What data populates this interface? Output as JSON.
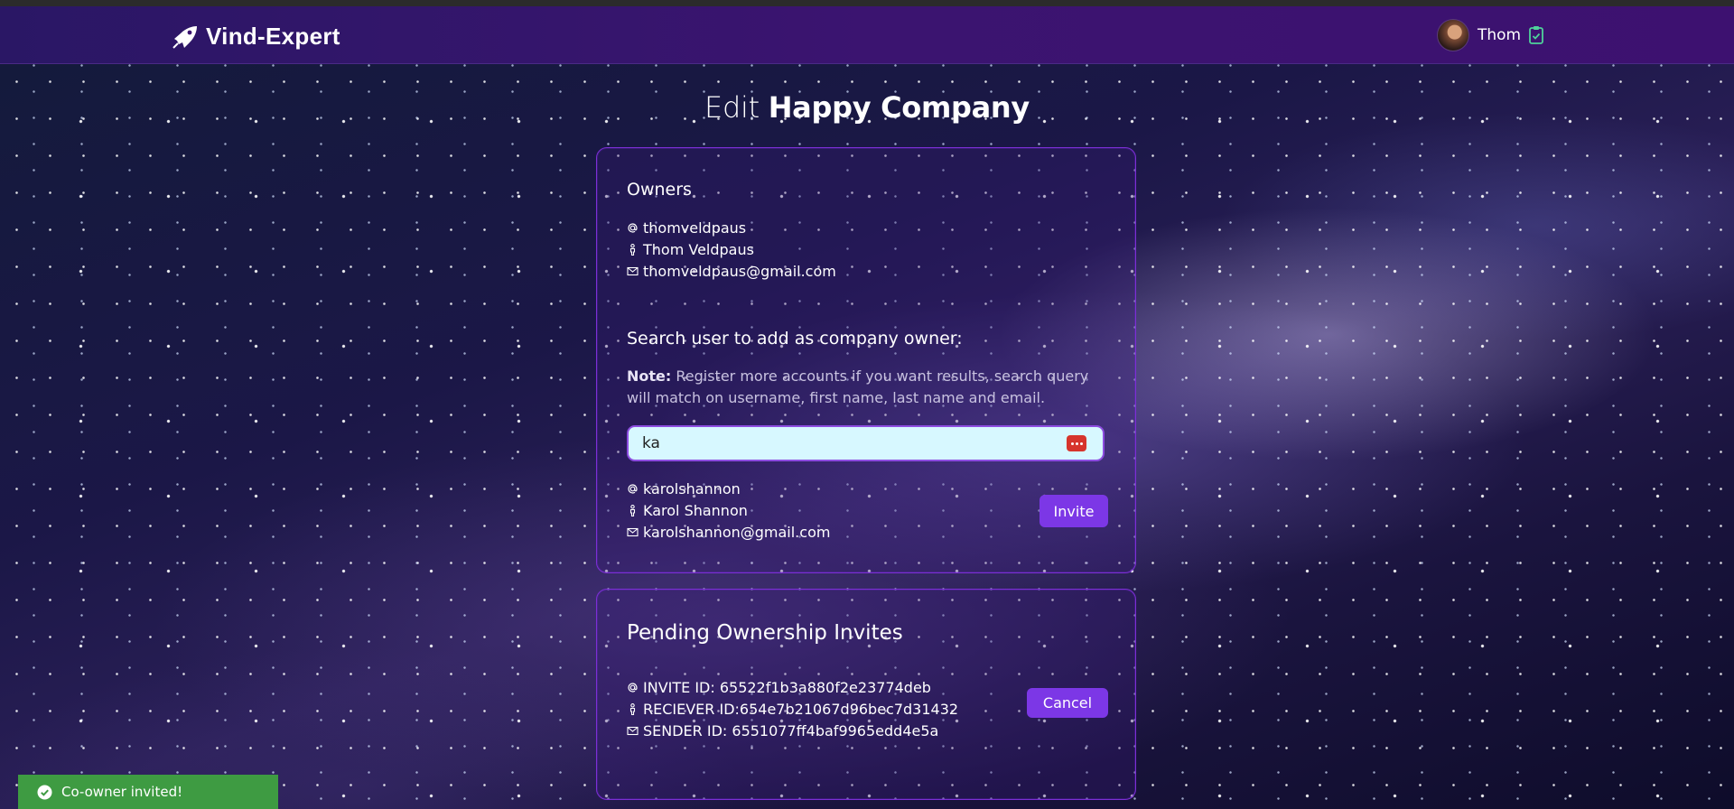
{
  "brand": {
    "name": "Vind-Expert",
    "logo_icon": "rocket-icon"
  },
  "user": {
    "name": "Thom",
    "clipboard_icon": "clipboard-check-icon"
  },
  "page": {
    "title_prefix": "Edit",
    "company_name": "Happy Company"
  },
  "owners": {
    "heading": "Owners",
    "username": "thomveldpaus",
    "full_name": "Thom Veldpaus",
    "email": "thomveldpaus@gmail.com"
  },
  "search": {
    "heading": "Search user to add as company owner:",
    "note_label": "Note:",
    "note_text": " Register more accounts if you want results, search query will match on username, first name, last name and email.",
    "query": "ka",
    "result": {
      "username": "karolshannon",
      "full_name": "Karol Shannon",
      "email": "karolshannon@gmail.com",
      "invite_label": "Invite"
    }
  },
  "pending": {
    "heading": "Pending Ownership Invites",
    "invite_id": "INVITE ID: 65522f1b3a880f2e23774deb",
    "receiver_id": "RECIEVER ID:654e7b21067d96bec7d31432",
    "sender_id": "SENDER ID: 6551077ff4baf9965edd4e5a",
    "cancel_label": "Cancel"
  },
  "toast": {
    "message": "Co-owner invited!"
  },
  "colors": {
    "accent": "#7c37e6",
    "topbar": "#3b1470",
    "toast": "#3e9b42",
    "input_bg": "#d7f8ff"
  }
}
